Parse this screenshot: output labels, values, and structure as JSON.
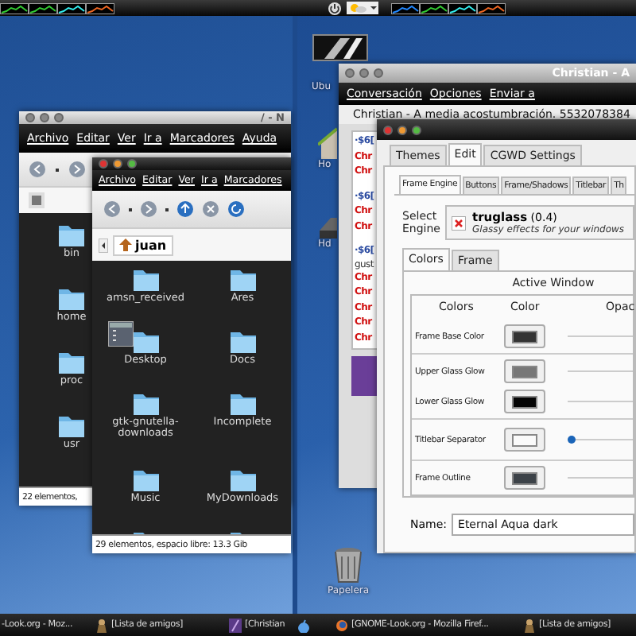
{
  "desktop_icons": [
    {
      "label": "Ubu",
      "kind": "computer"
    },
    {
      "label": "Ho",
      "kind": "home"
    },
    {
      "label": "Hd",
      "kind": "drive"
    },
    {
      "label": "Papelera",
      "kind": "trash"
    }
  ],
  "file_manager_back": {
    "title": "/ - N",
    "menu": [
      "Archivo",
      "Editar",
      "Ver",
      "Ir a",
      "Marcadores",
      "Ayuda"
    ],
    "folders": [
      "bin",
      "home",
      "proc",
      "usr"
    ],
    "status": "22 elementos, "
  },
  "file_manager_front": {
    "menu": [
      "Archivo",
      "Editar",
      "Ver",
      "Ir a",
      "Marcadores"
    ],
    "location": "juan",
    "folders": [
      "amsn_received",
      "Ares",
      "Desktop",
      "Docs",
      "gtk-gnutella-downloads",
      "Incomplete",
      "Music",
      "MyDownloads"
    ],
    "status": "29 elementos, espacio libre: 13.3 Gib"
  },
  "chat": {
    "title": "Christian - A",
    "menu": [
      "Conversación",
      "Opciones",
      "Enviar a"
    ],
    "header": "Christian - A media acostumbración. 5532078384",
    "lines": [
      {
        "kind": "meta",
        "text": "·$6["
      },
      {
        "kind": "name",
        "text": "Chr"
      },
      {
        "kind": "name",
        "text": "Chr"
      },
      {
        "kind": "meta",
        "text": "·$6["
      },
      {
        "kind": "name",
        "text": "Chr"
      },
      {
        "kind": "name",
        "text": "Chr"
      },
      {
        "kind": "meta",
        "text": "·$6["
      },
      {
        "kind": "body",
        "text": "gust"
      },
      {
        "kind": "name",
        "text": "Chr"
      },
      {
        "kind": "name",
        "text": "Chr"
      },
      {
        "kind": "name",
        "text": "Chr"
      },
      {
        "kind": "name",
        "text": "Chr"
      },
      {
        "kind": "name",
        "text": "Chr"
      }
    ]
  },
  "themer": {
    "tabs": [
      {
        "label": "Themes",
        "selected": false
      },
      {
        "label": "Edit",
        "selected": true
      },
      {
        "label": "CGWD Settings",
        "selected": false
      }
    ],
    "subtabs": [
      {
        "label": "Frame Engine",
        "selected": true
      },
      {
        "label": "Buttons",
        "selected": false
      },
      {
        "label": "Frame/Shadows",
        "selected": false
      },
      {
        "label": "Titlebar",
        "selected": false
      },
      {
        "label": "Th",
        "selected": false
      }
    ],
    "select_label": "Select Engine",
    "engine": {
      "name": "truglass",
      "version": "(0.4)",
      "description": "Glassy effects for your windows"
    },
    "color_tabs": [
      {
        "label": "Colors",
        "selected": true
      },
      {
        "label": "Frame",
        "selected": false
      }
    ],
    "section": "Active Window",
    "columns": [
      "Colors",
      "Color",
      "Opac"
    ],
    "groups": [
      [
        {
          "label": "Frame Base Color",
          "color": "#333333"
        }
      ],
      [
        {
          "label": "Upper Glass Glow",
          "color": "#777777"
        },
        {
          "label": "Lower Glass Glow",
          "color": "#050505"
        }
      ],
      [
        {
          "label": "Titlebar Separator",
          "color": "#fafafa",
          "level": 0
        }
      ],
      [
        {
          "label": "Frame Outline",
          "color": "#3c4248"
        }
      ]
    ],
    "name_label": "Name:",
    "name_value": "Eternal Aqua dark"
  },
  "taskbar": [
    {
      "kind": "browser",
      "label": "-Look.org - Moz..."
    },
    {
      "kind": "buddy",
      "label": "[Lista de amigos]"
    },
    {
      "kind": "chat",
      "label": "[Christian"
    },
    {
      "kind": "menu"
    },
    {
      "kind": "browser-icon",
      "label": "[GNOME-Look.org - Mozilla Firef..."
    },
    {
      "kind": "buddy",
      "label": "[Lista de amigos]"
    }
  ]
}
